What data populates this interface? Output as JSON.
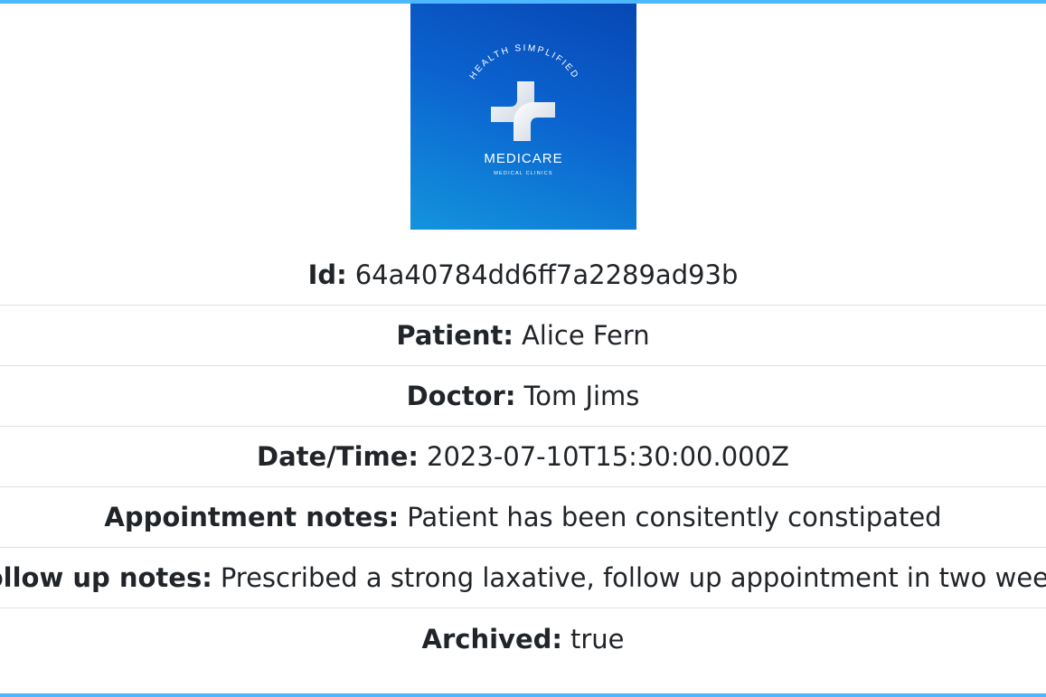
{
  "logo": {
    "arc_text": "HEALTH SIMPLIFIED",
    "brand": "MEDICARE",
    "subtitle": "MEDICAL CLINICS",
    "colors": {
      "gradient_start": "#0747b3",
      "gradient_end": "#1394dd",
      "mark": "#ffffff"
    }
  },
  "appointment": {
    "fields": [
      {
        "label": "Id:",
        "value": "64a40784dd6ff7a2289ad93b"
      },
      {
        "label": "Patient:",
        "value": "Alice Fern"
      },
      {
        "label": "Doctor:",
        "value": "Tom Jims"
      },
      {
        "label": "Date/Time:",
        "value": "2023-07-10T15:30:00.000Z"
      },
      {
        "label": "Appointment notes:",
        "value": "Patient has been consitently constipated"
      },
      {
        "label": "Follow up notes:",
        "value": "Prescribed a strong laxative, follow up appointment in two weeks"
      },
      {
        "label": "Archived:",
        "value": "true"
      }
    ]
  },
  "theme": {
    "accent": "#4db8ff",
    "divider": "#dee2e6",
    "text": "#212529"
  }
}
